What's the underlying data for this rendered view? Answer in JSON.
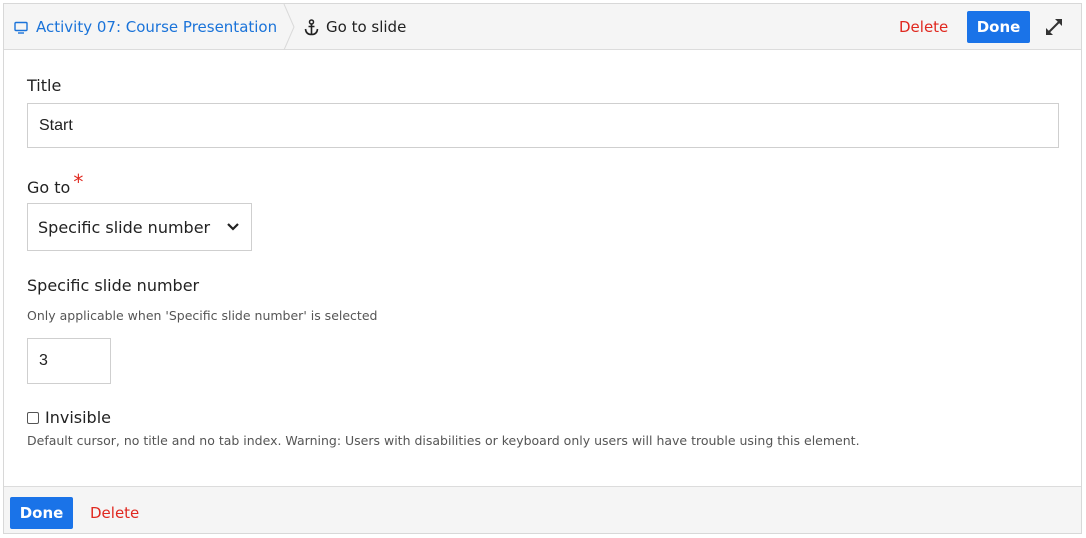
{
  "header": {
    "breadcrumb_parent": "Activity 07: Course Presentation",
    "breadcrumb_current": "Go to slide",
    "delete_label": "Delete",
    "done_label": "Done",
    "parent_icon": "monitor-icon",
    "current_icon": "anchor-icon",
    "expand_icon": "expand-icon"
  },
  "form": {
    "title_label": "Title",
    "title_value": "Start",
    "goto_label": "Go to",
    "goto_required_mark": "*",
    "goto_selected": "Specific slide number",
    "slide_number_label": "Specific slide number",
    "slide_number_description": "Only applicable when 'Specific slide number' is selected",
    "slide_number_value": "3",
    "invisible_label": "Invisible",
    "invisible_checked": false,
    "invisible_description": "Default cursor, no title and no tab index. Warning: Users with disabilities or keyboard only users will have trouble using this element."
  },
  "footer": {
    "done_label": "Done",
    "delete_label": "Delete"
  },
  "colors": {
    "accent": "#1a73e8",
    "link": "#1a73d9",
    "danger": "#e0281f",
    "header_bg": "#f5f5f5"
  }
}
